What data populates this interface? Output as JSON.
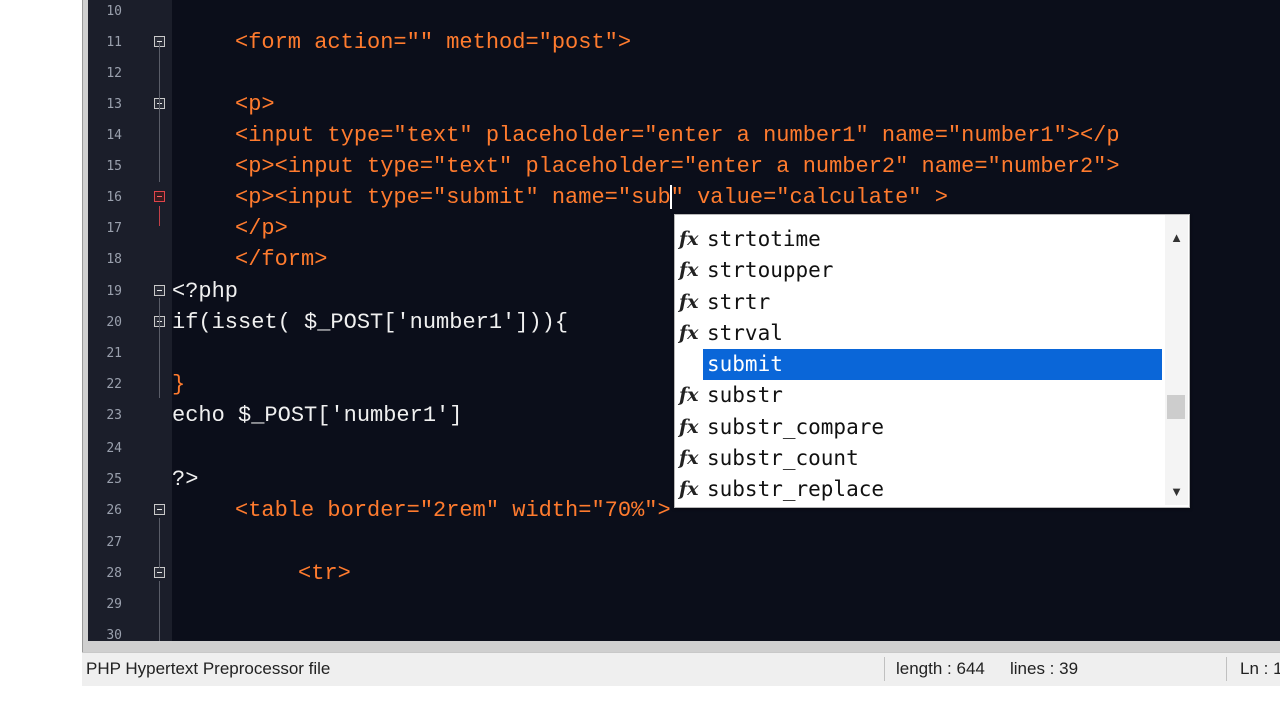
{
  "editor": {
    "lines": [
      {
        "n": "10",
        "code": ""
      },
      {
        "n": "11",
        "code": "<form action=\"\" method=\"post\">"
      },
      {
        "n": "12",
        "code": ""
      },
      {
        "n": "13",
        "code": "<p>"
      },
      {
        "n": "14",
        "code": "<input type=\"text\" placeholder=\"enter a number1\" name=\"number1\"></p"
      },
      {
        "n": "15",
        "code": "<p><input type=\"text\" placeholder=\"enter a number2\" name=\"number2\">"
      },
      {
        "n": "16",
        "code_before": "<p><input type=\"submit\" name=\"sub",
        "code_after": "\" value=\"calculate\" >"
      },
      {
        "n": "17",
        "code": "</p>"
      },
      {
        "n": "18",
        "code": "</form>"
      },
      {
        "n": "19",
        "code": "<?php"
      },
      {
        "n": "20",
        "code": "if(isset( $_POST['number1'])){"
      },
      {
        "n": "21",
        "code": ""
      },
      {
        "n": "22",
        "code": "}"
      },
      {
        "n": "23",
        "code": "echo $_POST['number1']"
      },
      {
        "n": "24",
        "code": ""
      },
      {
        "n": "25",
        "code": "?>"
      },
      {
        "n": "26",
        "code": "<table border=\"2rem\" width=\"70%\">"
      },
      {
        "n": "27",
        "code": ""
      },
      {
        "n": "28",
        "code": "<tr>"
      },
      {
        "n": "29",
        "code": ""
      },
      {
        "n": "30",
        "code": ""
      }
    ]
  },
  "autocomplete": {
    "items": [
      {
        "label": "strtotime",
        "icon": "function-icon"
      },
      {
        "label": "strtoupper",
        "icon": "function-icon"
      },
      {
        "label": "strtr",
        "icon": "function-icon"
      },
      {
        "label": "strval",
        "icon": "function-icon"
      },
      {
        "label": "submit",
        "icon": "",
        "selected": true
      },
      {
        "label": "substr",
        "icon": "function-icon"
      },
      {
        "label": "substr_compare",
        "icon": "function-icon"
      },
      {
        "label": "substr_count",
        "icon": "function-icon"
      },
      {
        "label": "substr_replace",
        "icon": "function-icon"
      }
    ],
    "fx_glyph": "fx",
    "scroll_up_glyph": "▲",
    "scroll_down_glyph": "▼"
  },
  "statusbar": {
    "file_type": "PHP Hypertext Preprocessor file",
    "length": "length : 644",
    "lines": "lines : 39",
    "position": "Ln : 1"
  }
}
